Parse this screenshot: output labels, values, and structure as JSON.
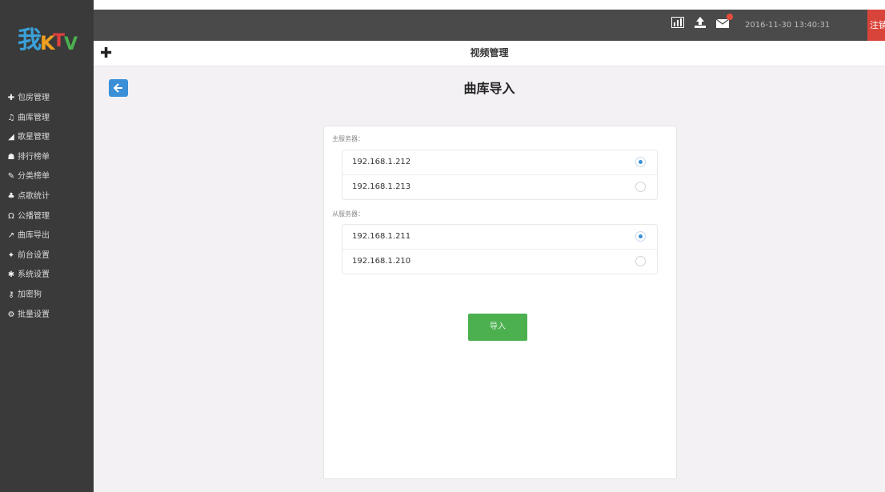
{
  "sidebar": {
    "logo_text": "我KTV",
    "items": [
      {
        "icon": "plus-icon",
        "glyph": "✚",
        "label": "包房管理"
      },
      {
        "icon": "music-icon",
        "glyph": "♫",
        "label": "曲库管理"
      },
      {
        "icon": "signal-icon",
        "glyph": "◢",
        "label": "歌星管理"
      },
      {
        "icon": "users-icon",
        "glyph": "☗",
        "label": "排行榜单"
      },
      {
        "icon": "edit-icon",
        "glyph": "✎",
        "label": "分类榜单"
      },
      {
        "icon": "sitemap-icon",
        "glyph": "♣",
        "label": "点歌统计"
      },
      {
        "icon": "headset-icon",
        "glyph": "Ω",
        "label": "公播管理"
      },
      {
        "icon": "export-icon",
        "glyph": "↗",
        "label": "曲库导出"
      },
      {
        "icon": "pin-icon",
        "glyph": "✦",
        "label": "前台设置"
      },
      {
        "icon": "gear-icon",
        "glyph": "✱",
        "label": "系统设置"
      },
      {
        "icon": "key-icon",
        "glyph": "⚷",
        "label": "加密狗"
      },
      {
        "icon": "cogs-icon",
        "glyph": "⚙",
        "label": "批量设置"
      }
    ]
  },
  "topbar": {
    "time": "2016-11-30 13:40:31",
    "logout_label": "注销",
    "icons": [
      "chart-icon",
      "upload-icon",
      "message-icon"
    ]
  },
  "subbar": {
    "title": "视频管理"
  },
  "page": {
    "title": "曲库导入",
    "master_label": "主服务器：",
    "slave_label": "从服务器：",
    "master_servers": [
      {
        "ip": "192.168.1.212",
        "selected": true
      },
      {
        "ip": "192.168.1.213",
        "selected": false
      }
    ],
    "slave_servers": [
      {
        "ip": "192.168.1.211",
        "selected": true
      },
      {
        "ip": "192.168.1.210",
        "selected": false
      }
    ],
    "import_label": "导入"
  },
  "colors": {
    "sidebar_bg": "#3a3a3a",
    "topbar_bg": "#4a4a4a",
    "accent_blue": "#3a8fd6",
    "import_green": "#4cb04f",
    "logout_red": "#d9443a",
    "content_bg": "#f4f1f4"
  }
}
